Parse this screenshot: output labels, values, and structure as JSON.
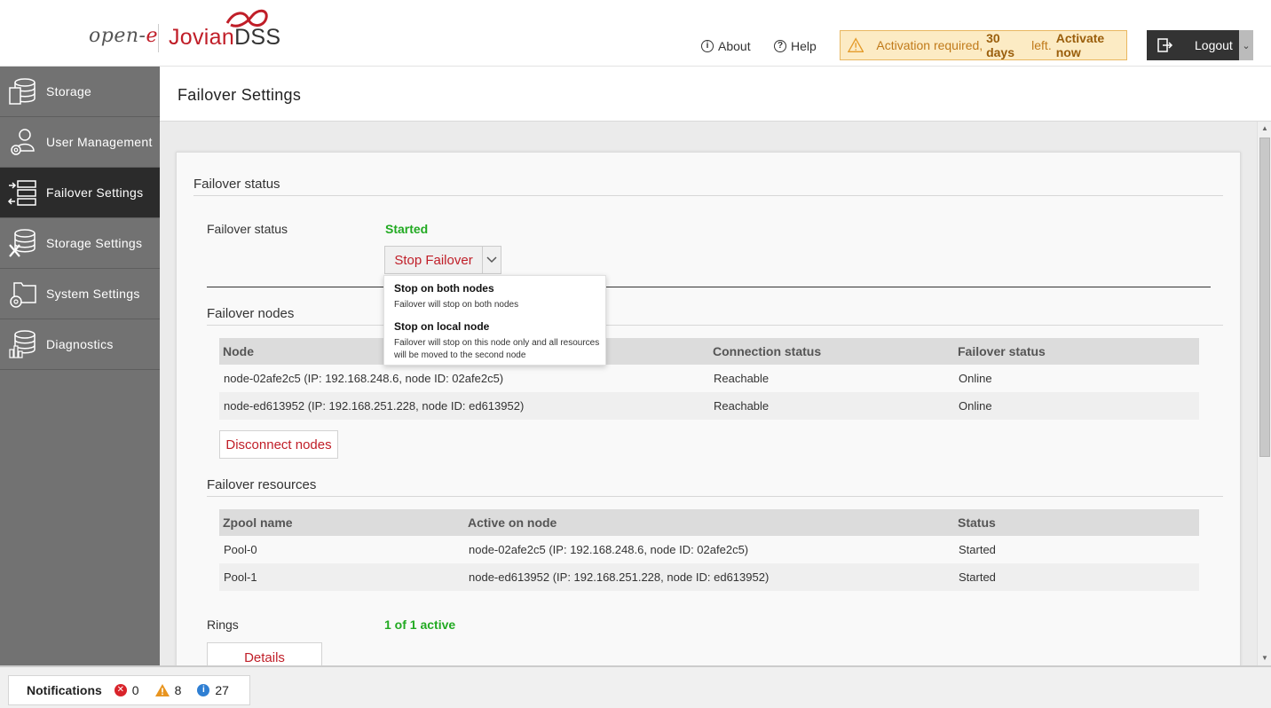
{
  "header": {
    "logo_opene_prefix": "open-",
    "logo_opene_suffix": "e",
    "logo_product_prefix": "Jovian",
    "logo_product_suffix": "DSS",
    "about_label": "About",
    "help_label": "Help",
    "activation_text_1": "Activation required, ",
    "activation_days": "30 days",
    "activation_text_2": " left.",
    "activation_link": "Activate now",
    "logout_label": "Logout"
  },
  "sidebar": {
    "items": [
      {
        "label": "Storage",
        "icon": "storage-icon"
      },
      {
        "label": "User Management",
        "icon": "user-management-icon"
      },
      {
        "label": "Failover Settings",
        "icon": "failover-icon",
        "active": true
      },
      {
        "label": "Storage Settings",
        "icon": "storage-settings-icon"
      },
      {
        "label": "System Settings",
        "icon": "system-settings-icon"
      },
      {
        "label": "Diagnostics",
        "icon": "diagnostics-icon"
      }
    ]
  },
  "page": {
    "title": "Failover Settings",
    "failover_status_section": "Failover status",
    "failover_status_label": "Failover status",
    "failover_status_value": "Started",
    "stop_button_label": "Stop Failover",
    "dropdown": [
      {
        "title": "Stop on both nodes",
        "desc": "Failover will stop on both nodes"
      },
      {
        "title": "Stop on local node",
        "desc": "Failover will stop on this node only and all resources will be moved to the second node"
      }
    ],
    "nodes_section": "Failover nodes",
    "nodes_table": {
      "headers": [
        "Node",
        "Connection status",
        "Failover status"
      ],
      "rows": [
        [
          "node-02afe2c5 (IP: 192.168.248.6, node ID: 02afe2c5)",
          "Reachable",
          "Online"
        ],
        [
          "node-ed613952 (IP: 192.168.251.228, node ID: ed613952)",
          "Reachable",
          "Online"
        ]
      ]
    },
    "disconnect_label": "Disconnect nodes",
    "resources_section": "Failover resources",
    "resources_table": {
      "headers": [
        "Zpool name",
        "Active on node",
        "Status"
      ],
      "rows": [
        [
          "Pool-0",
          "node-02afe2c5 (IP: 192.168.248.6, node ID: 02afe2c5)",
          "Started"
        ],
        [
          "Pool-1",
          "node-ed613952 (IP: 192.168.251.228, node ID: ed613952)",
          "Started"
        ]
      ]
    },
    "rings_label": "Rings",
    "rings_value": "1 of 1 active",
    "details_label": "Details"
  },
  "footer": {
    "notifications_label": "Notifications",
    "errors": "0",
    "warnings": "8",
    "info": "27"
  },
  "colors": {
    "accent_red": "#c01e28",
    "status_green": "#22aa22",
    "sidebar_bg": "#727272",
    "sidebar_active": "#2b2b2b"
  }
}
